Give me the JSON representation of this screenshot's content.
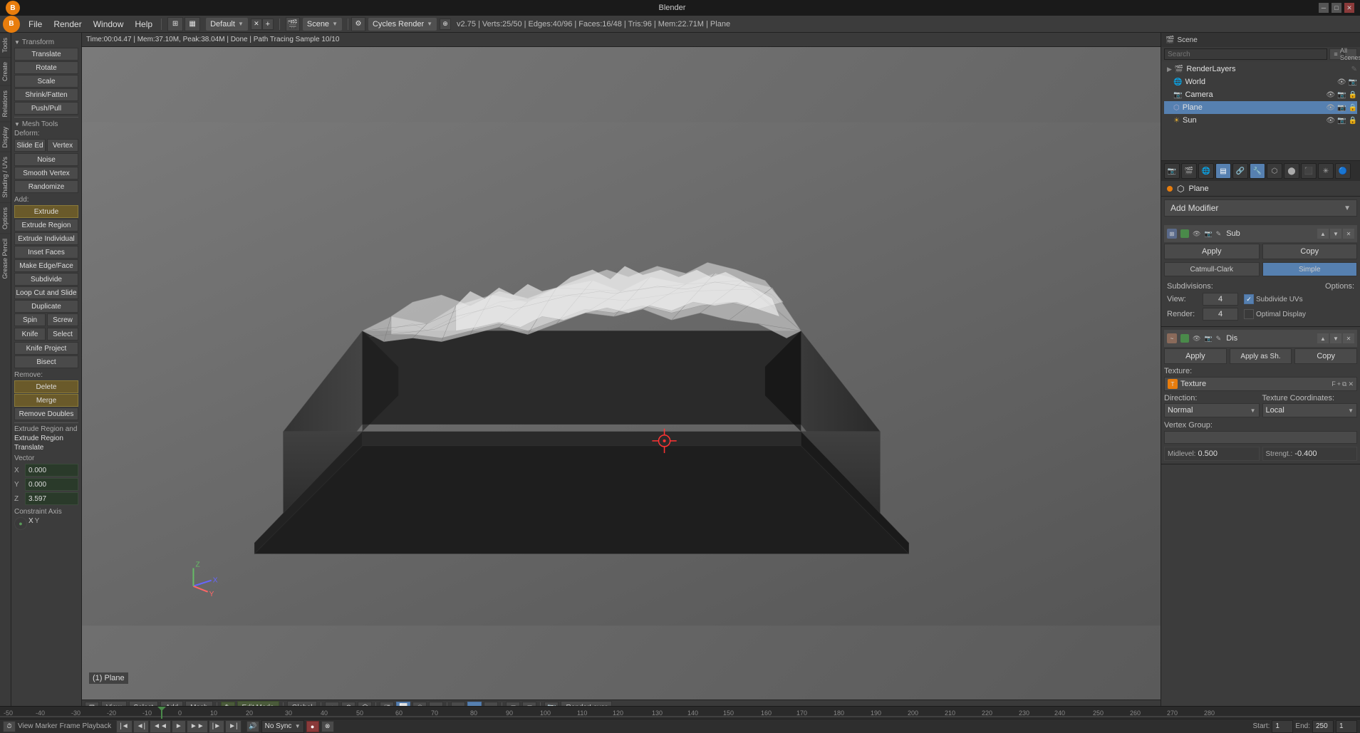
{
  "titlebar": {
    "title": "Blender"
  },
  "menubar": {
    "items": [
      "File",
      "Render",
      "Window",
      "Help"
    ],
    "workspace": "Default",
    "scene": "Scene",
    "engine": "Cycles Render",
    "status": "v2.75 | Verts:25/50 | Edges:40/96 | Faces:16/48 | Tris:96 | Mem:22.71M | Plane"
  },
  "viewport": {
    "status_line": "Time:00:04.47 | Mem:37.10M, Peak:38.04M | Done | Path Tracing Sample 10/10",
    "object_name": "(1) Plane",
    "mode": "Edit Mode",
    "pivot": "Global",
    "render_layer": "RenderLayer"
  },
  "tools": {
    "transform_section": "Transform",
    "transform_tools": [
      "Translate",
      "Rotate",
      "Scale",
      "Shrink/Fatten",
      "Push/Pull"
    ],
    "mesh_tools_section": "Mesh Tools",
    "deform_label": "Deform:",
    "deform_tools": [
      "Slide Ed",
      "Vertex",
      "Noise",
      "Smooth Vertex",
      "Randomize"
    ],
    "add_label": "Add:",
    "add_tools": [
      "Extrude",
      "Extrude Region",
      "Extrude Individual",
      "Inset Faces",
      "Make Edge/Face",
      "Subdivide",
      "Loop Cut and Slide",
      "Duplicate"
    ],
    "spin_label": "Spin",
    "screw_label": "Screw",
    "knife_label": "Knife",
    "select_label": "Select",
    "knife_project_label": "Knife Project",
    "bisect_label": "Bisect",
    "remove_label": "Remove:",
    "delete_label": "Delete",
    "merge_label": "Merge",
    "remove_doubles_label": "Remove Doubles",
    "extrude_info": "Extrude Region and",
    "extrude_region": "Extrude Region",
    "translate_label": "Translate",
    "vector_label": "Vector",
    "x_val": "0.000",
    "y_val": "0.000",
    "z_val": "3.597",
    "constraint_axis": "Constraint Axis",
    "axis_x": "X",
    "axis_y": "Y"
  },
  "outliner": {
    "title": "Scene",
    "items": [
      {
        "name": "RenderLayers",
        "type": "renderlayers",
        "indent": 0
      },
      {
        "name": "World",
        "type": "world",
        "indent": 0
      },
      {
        "name": "Camera",
        "type": "camera",
        "indent": 0
      },
      {
        "name": "Plane",
        "type": "mesh",
        "indent": 0,
        "selected": true
      },
      {
        "name": "Sun",
        "type": "light",
        "indent": 0
      }
    ]
  },
  "properties": {
    "object_name": "Plane",
    "add_modifier_label": "Add Modifier",
    "modifiers": [
      {
        "name": "Sub",
        "type": "subsurf",
        "apply_label": "Apply",
        "copy_label": "Copy",
        "catmull_label": "Catmull-Clark",
        "simple_label": "Simple",
        "subdivisions_label": "Subdivisions:",
        "options_label": "Options:",
        "view_label": "View:",
        "view_value": "4",
        "render_label": "Render:",
        "render_value": "4",
        "subdivide_uvs_label": "Subdivide UVs",
        "optimal_display_label": "Optimal Display"
      },
      {
        "name": "Dis",
        "type": "displace",
        "apply_label": "Apply",
        "apply_as_sh_label": "Apply as Sh.",
        "copy_label": "Copy",
        "texture_label": "Texture:",
        "texture_name": "Texture",
        "direction_label": "Direction:",
        "direction_value": "Normal",
        "texture_coords_label": "Texture Coordinates:",
        "texture_coords_value": "Local",
        "vertex_group_label": "Vertex Group:",
        "midlevel_label": "Midlevel:",
        "midlevel_value": "0.500",
        "strength_label": "Strengt.:",
        "strength_value": "-0.400"
      }
    ]
  },
  "bottom_toolbar": {
    "view_label": "View",
    "select_label": "Select",
    "add_label": "Add",
    "mesh_label": "Mesh",
    "mode_label": "Edit Mode",
    "pivot_label": "Global",
    "render_layer_label": "RenderLayer"
  },
  "frame_controls": {
    "start_label": "Start:",
    "start_value": "1",
    "end_label": "End:",
    "end_value": "250",
    "current_frame": "1",
    "sync_label": "No Sync"
  },
  "icons": {
    "arrow_down": "▼",
    "arrow_right": "▶",
    "check": "✓",
    "close": "✕",
    "eye": "👁",
    "camera_icon": "📷",
    "mesh_icon": "⬡",
    "light_icon": "💡",
    "world_icon": "🌐"
  }
}
